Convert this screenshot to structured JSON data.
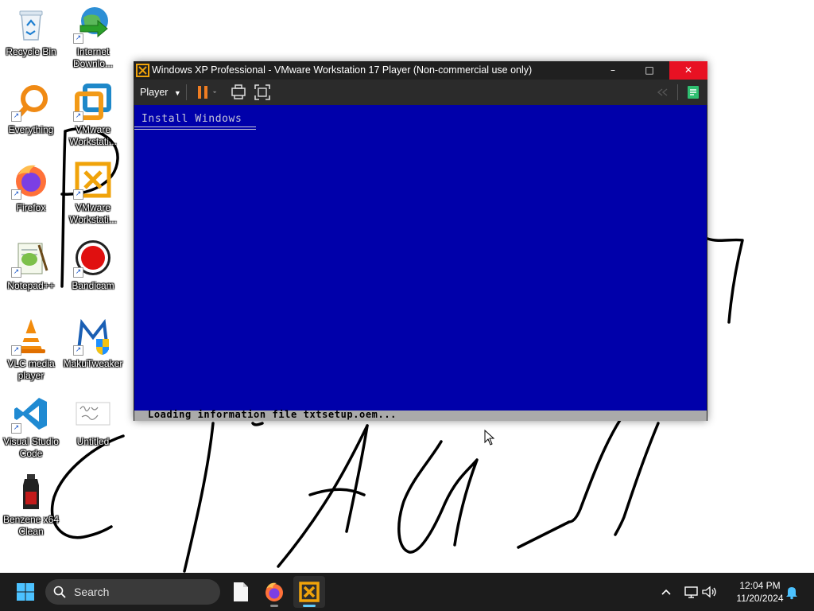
{
  "desktop": {
    "icons": [
      {
        "label": "Recycle Bin"
      },
      {
        "label": "Internet\nDownlo..."
      },
      {
        "label": "Everything"
      },
      {
        "label": "VMware\nWorkstati..."
      },
      {
        "label": "Firefox"
      },
      {
        "label": "VMware\nWorkstati..."
      },
      {
        "label": "Notepad++"
      },
      {
        "label": "Bandicam"
      },
      {
        "label": "VLC media\nplayer"
      },
      {
        "label": "MakuTweaker"
      },
      {
        "label": "Visual Studio\nCode"
      },
      {
        "label": "Untitled"
      },
      {
        "label": "Benzene x64\nClean"
      }
    ]
  },
  "vmware": {
    "title": "Windows XP Professional - VMware Workstation 17 Player (Non-commercial use only)",
    "player_menu": "Player",
    "window_controls": {
      "minimize": "–",
      "maximize": "□",
      "close": "✕"
    },
    "guest": {
      "setup_title": "Install Windows",
      "status": "Loading information file txtsetup.oem...",
      "background_color": "#0000aa"
    }
  },
  "taskbar": {
    "search_label": "Search",
    "time": "12:04 PM",
    "date": "11/20/2024",
    "pinned": [
      "file-explorer-icon",
      "firefox-icon",
      "vmware-player-icon"
    ]
  },
  "colors": {
    "accent": "#60cdff",
    "close_red": "#e81123",
    "vmware_orange": "#f0a30a"
  }
}
